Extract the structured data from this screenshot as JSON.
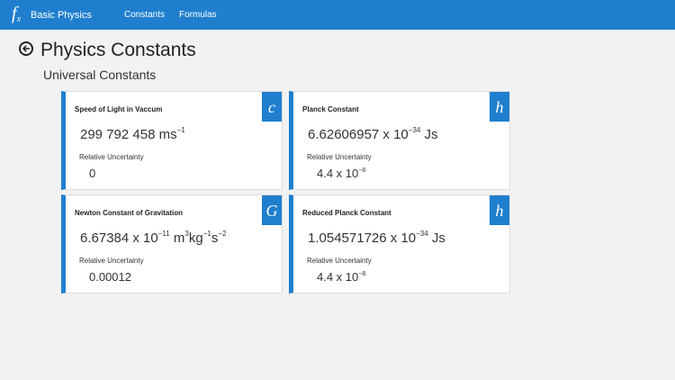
{
  "app": {
    "logo": "f",
    "logo_sub": "x",
    "title": "Basic Physics"
  },
  "nav": {
    "constants": "Constants",
    "formulas": "Formulas"
  },
  "page": {
    "title": "Physics Constants",
    "section": "Universal Constants",
    "uncertainty_label": "Relative Uncertainty"
  },
  "constants": [
    {
      "name": "Speed of Light in Vaccum",
      "symbol": "c",
      "value": {
        "mantissa": "299 792 458 ms",
        "exp": "−1",
        "unit": ""
      },
      "uncertainty": {
        "mantissa": "0",
        "exp": ""
      }
    },
    {
      "name": "Planck Constant",
      "symbol": "h",
      "value": {
        "mantissa": "6.62606957 x 10",
        "exp": "−34",
        "unit": " Js"
      },
      "uncertainty": {
        "mantissa": "4.4 x 10",
        "exp": "−8"
      }
    },
    {
      "name": "Newton Constant of Gravitation",
      "symbol": "G",
      "value": {
        "mantissa": "6.67384 x 10",
        "exp": "−11",
        "unit": " m",
        "unit_exp": "3",
        "unit2": "kg",
        "unit2_exp": "−1",
        "unit3": "s",
        "unit3_exp": "−2"
      },
      "uncertainty": {
        "mantissa": "0.00012",
        "exp": ""
      }
    },
    {
      "name": "Reduced Planck Constant",
      "symbol": "h",
      "value": {
        "mantissa": "1.054571726 x 10",
        "exp": "−34",
        "unit": " Js"
      },
      "uncertainty": {
        "mantissa": "4.4 x 10",
        "exp": "−8"
      }
    }
  ],
  "colors": {
    "accent": "#1f7fce",
    "background": "#f2f2f2"
  }
}
